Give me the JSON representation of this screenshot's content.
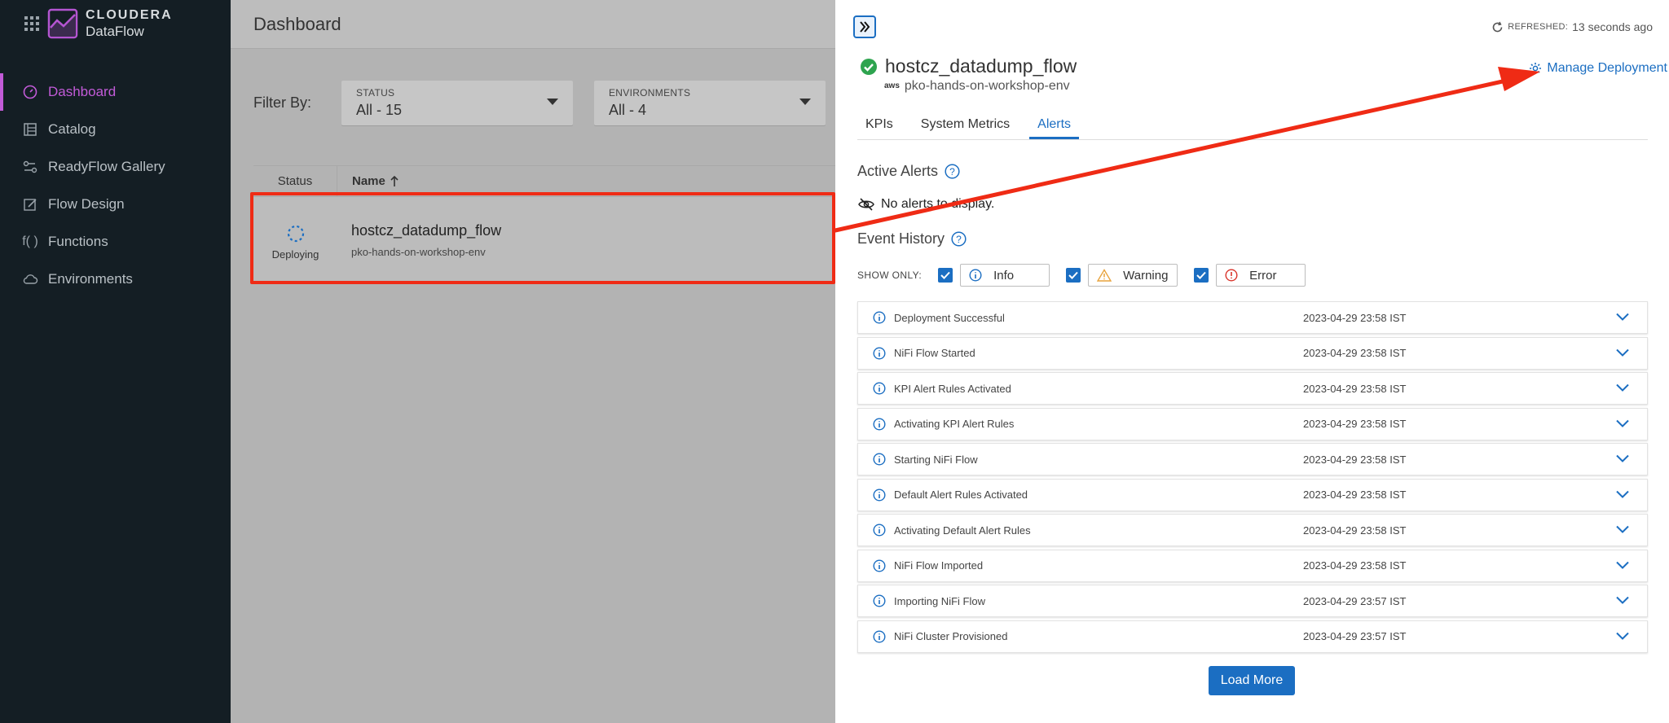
{
  "brand": {
    "name": "CLOUDERA",
    "product": "DataFlow"
  },
  "sidebar": {
    "items": [
      {
        "label": "Dashboard",
        "icon": "gauge-icon",
        "active": true
      },
      {
        "label": "Catalog",
        "icon": "catalog-icon"
      },
      {
        "label": "ReadyFlow Gallery",
        "icon": "readyflow-icon"
      },
      {
        "label": "Flow Design",
        "icon": "flow-design-icon"
      },
      {
        "label": "Functions",
        "icon": "functions-icon"
      },
      {
        "label": "Environments",
        "icon": "cloud-icon"
      }
    ]
  },
  "main": {
    "title": "Dashboard",
    "filter_label": "Filter By:",
    "filters": [
      {
        "title": "STATUS",
        "value": "All - 15"
      },
      {
        "title": "ENVIRONMENTS",
        "value": "All - 4"
      }
    ],
    "columns": {
      "status": "Status",
      "name": "Name"
    },
    "row": {
      "status": "Deploying",
      "flow": "hostcz_datadump_flow",
      "env": "pko-hands-on-workshop-env"
    }
  },
  "panel": {
    "refreshed_label": "REFRESHED:",
    "refreshed_value": "13 seconds ago",
    "flow_name": "hostcz_datadump_flow",
    "aws_label": "aws",
    "env": "pko-hands-on-workshop-env",
    "manage": "Manage Deployment",
    "tabs": [
      "KPIs",
      "System Metrics",
      "Alerts"
    ],
    "active_tab": "Alerts",
    "active_alerts_title": "Active Alerts",
    "no_alerts": "No alerts to display.",
    "event_history_title": "Event History",
    "show_only": "SHOW ONLY:",
    "filters": [
      "Info",
      "Warning",
      "Error"
    ],
    "events": [
      {
        "name": "Deployment Successful",
        "time": "2023-04-29 23:58 IST"
      },
      {
        "name": "NiFi Flow Started",
        "time": "2023-04-29 23:58 IST"
      },
      {
        "name": "KPI Alert Rules Activated",
        "time": "2023-04-29 23:58 IST"
      },
      {
        "name": "Activating KPI Alert Rules",
        "time": "2023-04-29 23:58 IST"
      },
      {
        "name": "Starting NiFi Flow",
        "time": "2023-04-29 23:58 IST"
      },
      {
        "name": "Default Alert Rules Activated",
        "time": "2023-04-29 23:58 IST"
      },
      {
        "name": "Activating Default Alert Rules",
        "time": "2023-04-29 23:58 IST"
      },
      {
        "name": "NiFi Flow Imported",
        "time": "2023-04-29 23:58 IST"
      },
      {
        "name": "Importing NiFi Flow",
        "time": "2023-04-29 23:57 IST"
      },
      {
        "name": "NiFi Cluster Provisioned",
        "time": "2023-04-29 23:57 IST"
      }
    ],
    "load_more": "Load More"
  },
  "colors": {
    "accent": "#1b6ec2",
    "brand": "#c25bd8",
    "annotation": "#ef2b15",
    "success": "#2ea44f"
  }
}
